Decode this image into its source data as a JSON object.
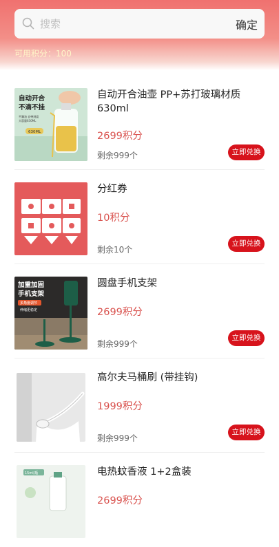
{
  "search": {
    "placeholder": "搜索",
    "confirm_label": "确定"
  },
  "points_label": "可用积分：100",
  "items": [
    {
      "title": "自动开合油壶 PP+苏打玻璃材质630ml",
      "price": "2699积分",
      "stock": "剩余999个",
      "button": "立即兑换",
      "thumb": {
        "caption1": "自动开合",
        "caption2": "不滴不挂",
        "sub1": "不漏油 自带刻度",
        "sub2": "大容量630ML",
        "tag": "630ML"
      }
    },
    {
      "title": "分红券",
      "price": "10积分",
      "stock": "剩余10个",
      "button": "立即兑换"
    },
    {
      "title": "圆盘手机支架",
      "price": "2699积分",
      "stock": "剩余999个",
      "button": "立即兑换",
      "thumb": {
        "caption1": "加重加固",
        "caption2": "手机支架",
        "sub1": "多角度调节",
        "sub2": "伸缩更稳定"
      }
    },
    {
      "title": "高尔夫马桶刷 (带挂钩)",
      "price": "1999积分",
      "stock": "剩余999个",
      "button": "立即兑换"
    },
    {
      "title": "电热蚊香液 1+2盒装",
      "price": "2699积分",
      "stock": "剩余999个",
      "button": "立即兑换",
      "thumb": {
        "tag": "15ml/瓶"
      }
    }
  ],
  "colors": {
    "accent": "#d7131c",
    "price": "#d9534f",
    "header": "#f0716f"
  }
}
